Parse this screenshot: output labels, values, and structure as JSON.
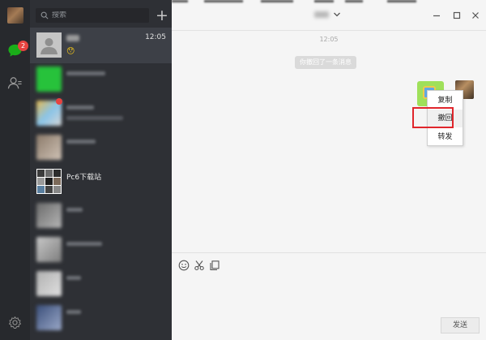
{
  "sidebar": {
    "unread_badge": "2",
    "icons": [
      "avatar",
      "chat-icon",
      "contacts-icon",
      "settings-icon"
    ]
  },
  "search": {
    "placeholder": "搜索"
  },
  "add_label": "+",
  "conversations": [
    {
      "name": "",
      "time": "12:05",
      "preview": "😯",
      "active": true
    },
    {
      "name": "",
      "time": "",
      "preview": "",
      "active": false
    },
    {
      "name": "",
      "time": "",
      "preview": "",
      "active": false
    },
    {
      "name": "",
      "time": "",
      "preview": "",
      "active": false
    },
    {
      "name": "Pc6下载站",
      "time": "",
      "preview": "",
      "active": false
    },
    {
      "name": "",
      "time": "",
      "preview": "",
      "active": false
    },
    {
      "name": "",
      "time": "",
      "preview": "",
      "active": false
    },
    {
      "name": "",
      "time": "",
      "preview": "",
      "active": false
    },
    {
      "name": "",
      "time": "",
      "preview": "",
      "active": false
    }
  ],
  "chat": {
    "title": "",
    "timestamp": "12:05",
    "system_message": "你撤回了一条消息",
    "context_menu": [
      "复制",
      "撤回",
      "转发"
    ],
    "send_label": "发送"
  },
  "colors": {
    "rail_bg": "#27292d",
    "list_bg": "#2e3035",
    "active_item": "#3d4047",
    "chat_bg": "#f5f5f5",
    "badge": "#e64340",
    "my_bubble": "#9fe05a",
    "highlight": "#e0262c"
  }
}
